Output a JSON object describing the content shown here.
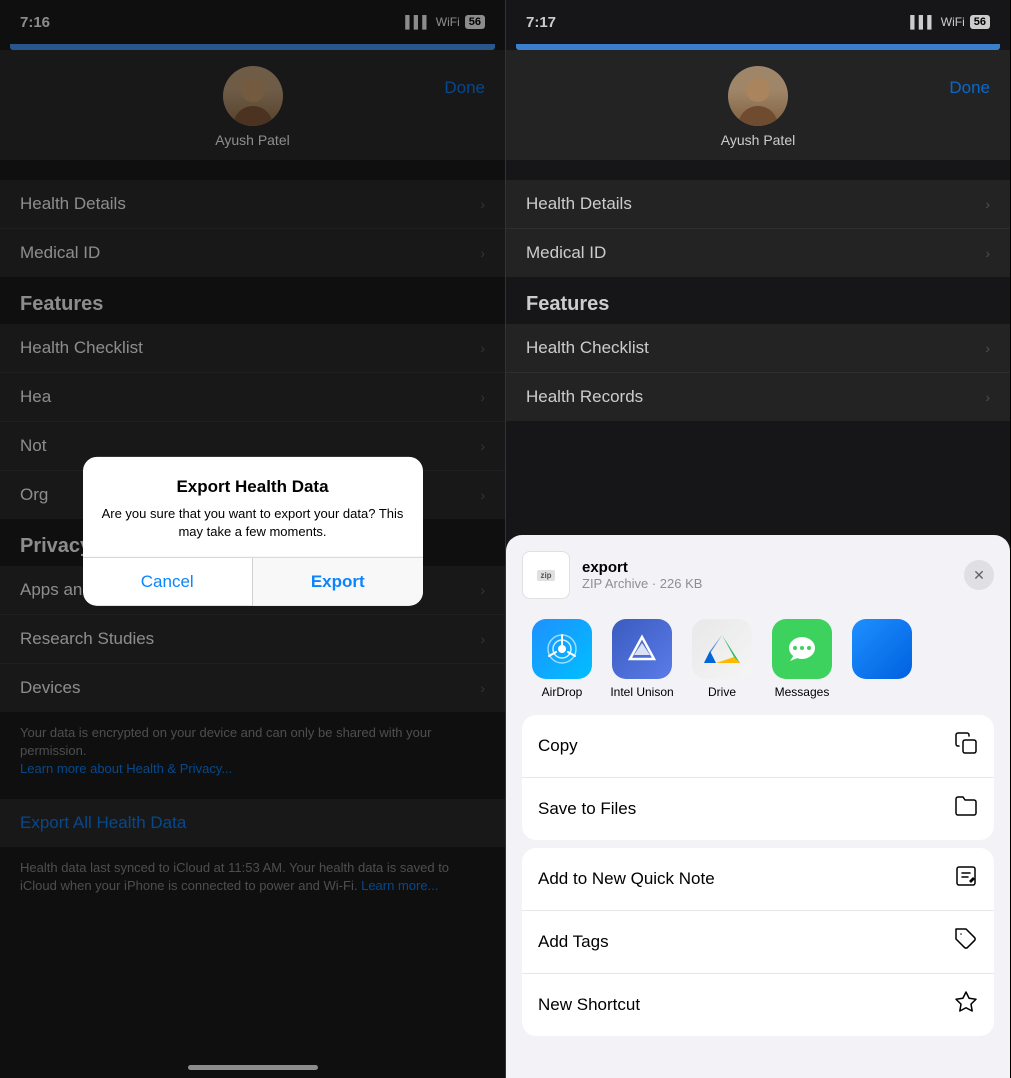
{
  "left_phone": {
    "status_time": "7:16",
    "profile_name": "Ayush Patel",
    "done_label": "Done",
    "sections": [
      {
        "items": [
          {
            "label": "Health Details"
          },
          {
            "label": "Medical ID"
          }
        ]
      }
    ],
    "features_header": "Features",
    "features_items": [
      {
        "label": "Health Checklist"
      },
      {
        "label": "Hea"
      },
      {
        "label": "Not"
      },
      {
        "label": "Org"
      }
    ],
    "privacy_header": "Privacy",
    "privacy_items": [
      {
        "label": "Apps and Services"
      },
      {
        "label": "Research Studies"
      },
      {
        "label": "Devices"
      }
    ],
    "privacy_text": "Your data is encrypted on your device and can only be shared with your permission.",
    "privacy_link": "Learn more about Health & Privacy...",
    "export_link": "Export All Health Data",
    "sync_text": "Health data last synced to iCloud at 11:53 AM. Your health data is saved to iCloud when your iPhone is connected to power and Wi-Fi.",
    "sync_link": "Learn more...",
    "dialog": {
      "title": "Export Health Data",
      "message": "Are you sure that you want to export your data? This may take a few moments.",
      "cancel_label": "Cancel",
      "export_label": "Export"
    }
  },
  "right_phone": {
    "status_time": "7:17",
    "profile_name": "Ayush Patel",
    "done_label": "Done",
    "sections": [
      {
        "items": [
          {
            "label": "Health Details"
          },
          {
            "label": "Medical ID"
          }
        ]
      }
    ],
    "features_header": "Features",
    "features_items": [
      {
        "label": "Health Checklist"
      },
      {
        "label": "Health Records"
      }
    ],
    "share_sheet": {
      "file_name": "export",
      "file_type": "ZIP Archive · 226 KB",
      "zip_label": "zip",
      "apps": [
        {
          "label": "AirDrop"
        },
        {
          "label": "Intel Unison"
        },
        {
          "label": "Drive"
        },
        {
          "label": "Messages"
        }
      ],
      "actions": [
        {
          "label": "Copy",
          "icon": "📋"
        },
        {
          "label": "Save to Files",
          "icon": "📁"
        }
      ],
      "actions2": [
        {
          "label": "Add to New Quick Note",
          "icon": "📝"
        },
        {
          "label": "Add Tags",
          "icon": "🏷"
        },
        {
          "label": "New Shortcut",
          "icon": "⬡"
        }
      ]
    }
  },
  "icons": {
    "copy": "copy-icon",
    "files": "folder-icon",
    "quick_note": "note-icon",
    "tags": "tag-icon",
    "shortcut": "shortcut-icon"
  }
}
